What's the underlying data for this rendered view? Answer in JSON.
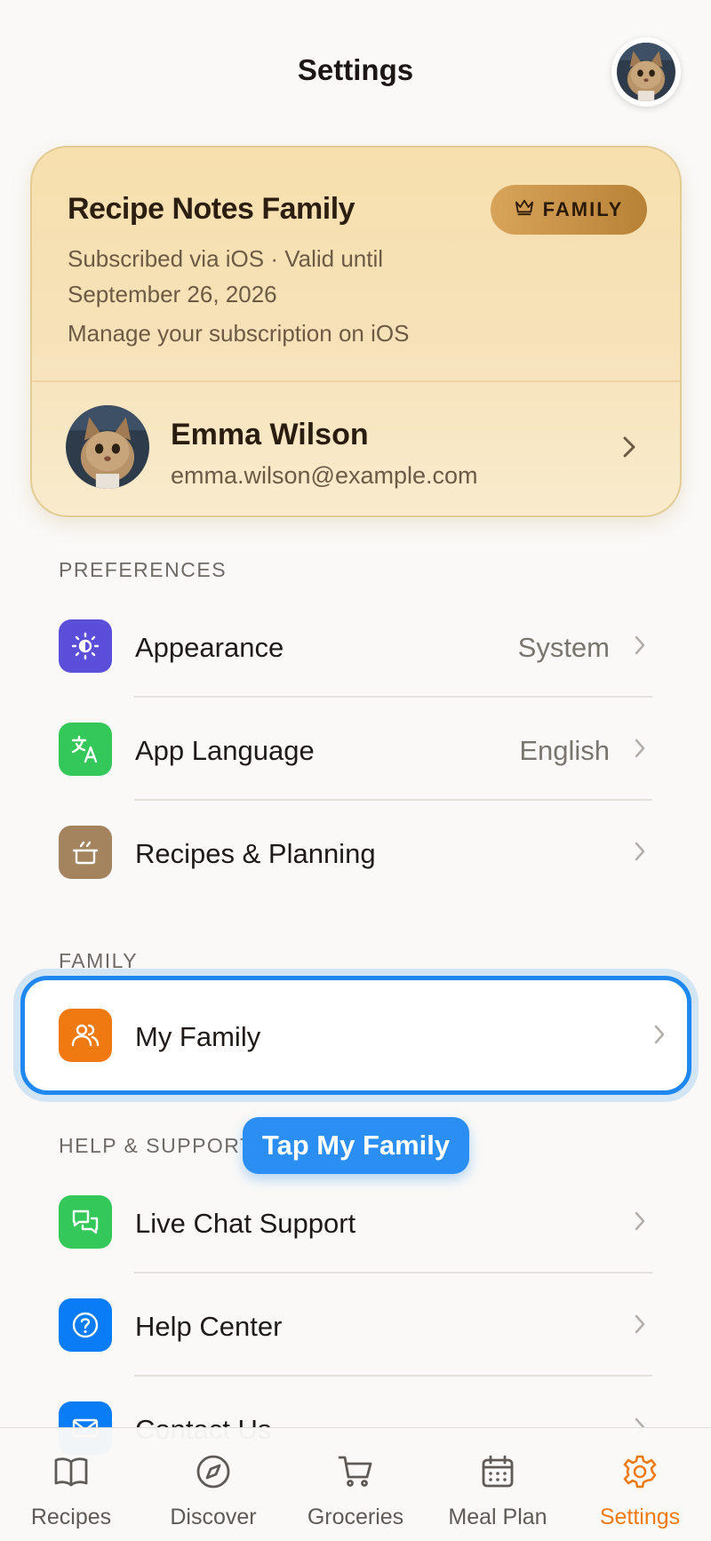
{
  "header": {
    "title": "Settings"
  },
  "subscription": {
    "plan_name": "Recipe Notes Family",
    "badge": "FAMILY",
    "subscribed_via": "Subscribed via iOS · Valid until",
    "valid_until": "September 26, 2026",
    "manage_text": "Manage your subscription on iOS"
  },
  "user": {
    "name": "Emma Wilson",
    "email": "emma.wilson@example.com"
  },
  "sections": {
    "preferences": {
      "label": "PREFERENCES",
      "items": [
        {
          "label": "Appearance",
          "value": "System",
          "icon": "appearance-icon",
          "color": "#5b4fd9"
        },
        {
          "label": "App Language",
          "value": "English",
          "icon": "translate-icon",
          "color": "#34c759"
        },
        {
          "label": "Recipes & Planning",
          "value": "",
          "icon": "pot-icon",
          "color": "#a3845f"
        }
      ]
    },
    "family": {
      "label": "FAMILY",
      "items": [
        {
          "label": "My Family",
          "icon": "users-icon",
          "color": "#f07a12"
        }
      ]
    },
    "help": {
      "label": "HELP & SUPPORT",
      "items": [
        {
          "label": "Live Chat Support",
          "icon": "chat-icon",
          "color": "#34c759"
        },
        {
          "label": "Help Center",
          "icon": "help-icon",
          "color": "#0a7cf5"
        },
        {
          "label": "Contact Us",
          "icon": "mail-icon",
          "color": "#0a7cf5"
        }
      ]
    }
  },
  "tooltip": {
    "text": "Tap My Family"
  },
  "tabbar": {
    "tabs": [
      {
        "label": "Recipes",
        "icon": "book-icon"
      },
      {
        "label": "Discover",
        "icon": "compass-icon"
      },
      {
        "label": "Groceries",
        "icon": "cart-icon"
      },
      {
        "label": "Meal Plan",
        "icon": "calendar-icon"
      },
      {
        "label": "Settings",
        "icon": "gear-icon",
        "active": true
      }
    ],
    "active_color": "#f07a12"
  }
}
